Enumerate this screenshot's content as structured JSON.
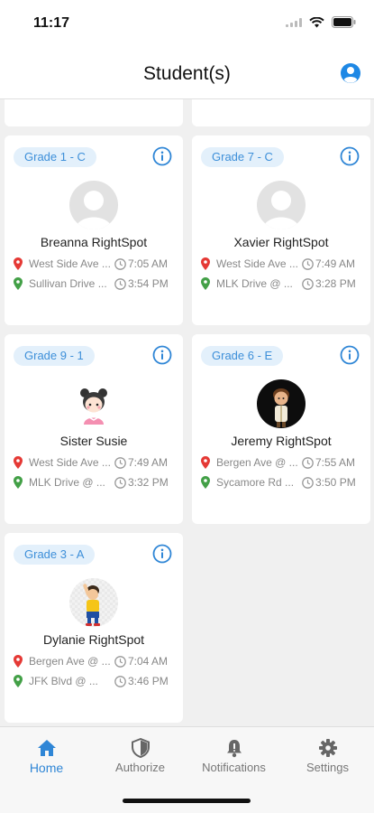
{
  "status_bar": {
    "time": "11:17"
  },
  "header": {
    "title": "Student(s)",
    "user_icon": "user-circle-icon"
  },
  "colors": {
    "accent": "#2f86d6",
    "badge_bg": "#e3f0fb",
    "pickup_pin": "#e53935",
    "dropoff_pin": "#43a047"
  },
  "students": [
    {
      "grade": "Grade 1 - C",
      "name": "Breanna RightSpot",
      "pickup_stop": "West Side Ave ...",
      "pickup_time": "7:05 AM",
      "dropoff_stop": "Sullivan Drive ...",
      "dropoff_time": "3:54 PM",
      "avatar": "placeholder"
    },
    {
      "grade": "Grade 7 - C",
      "name": "Xavier RightSpot",
      "pickup_stop": "West Side Ave ...",
      "pickup_time": "7:49 AM",
      "dropoff_stop": "MLK Drive @ ...",
      "dropoff_time": "3:28 PM",
      "avatar": "placeholder"
    },
    {
      "grade": "Grade 9 - 1",
      "name": "Sister Susie",
      "pickup_stop": "West Side Ave ...",
      "pickup_time": "7:49 AM",
      "dropoff_stop": "MLK Drive @ ...",
      "dropoff_time": "3:32 PM",
      "avatar": "cartoon-girl"
    },
    {
      "grade": "Grade 6 - E",
      "name": "Jeremy RightSpot",
      "pickup_stop": "Bergen Ave @ ...",
      "pickup_time": "7:55 AM",
      "dropoff_stop": "Sycamore Rd ...",
      "dropoff_time": "3:50 PM",
      "avatar": "cartoon-boy-dark"
    },
    {
      "grade": "Grade 3 - A",
      "name": "Dylanie RightSpot",
      "pickup_stop": "Bergen Ave @ ...",
      "pickup_time": "7:04 AM",
      "dropoff_stop": "JFK Blvd @ ...",
      "dropoff_time": "3:46 PM",
      "avatar": "cartoon-kid-waving"
    }
  ],
  "tabs": [
    {
      "label": "Home",
      "icon": "home-icon",
      "active": true
    },
    {
      "label": "Authorize",
      "icon": "shield-icon",
      "active": false
    },
    {
      "label": "Notifications",
      "icon": "bell-icon",
      "active": false
    },
    {
      "label": "Settings",
      "icon": "gear-icon",
      "active": false
    }
  ]
}
